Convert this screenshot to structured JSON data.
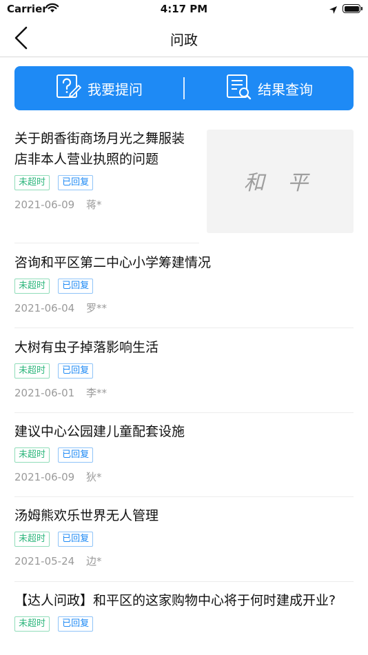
{
  "status_bar": {
    "carrier": "Carrier",
    "time": "4:17 PM"
  },
  "nav": {
    "title": "问政"
  },
  "actions": {
    "ask_label": "我要提问",
    "result_label": "结果查询"
  },
  "items": [
    {
      "title": "关于朗香街商场月光之舞服装店非本人营业执照的问题",
      "tag_time": "未超时",
      "tag_reply": "已回复",
      "date": "2021-06-09",
      "name": "蒋*",
      "thumb_text": "和 平"
    },
    {
      "title": "咨询和平区第二中心小学筹建情况",
      "tag_time": "未超时",
      "tag_reply": "已回复",
      "date": "2021-06-04",
      "name": "罗**"
    },
    {
      "title": "大树有虫子掉落影响生活",
      "tag_time": "未超时",
      "tag_reply": "已回复",
      "date": "2021-06-01",
      "name": "李**"
    },
    {
      "title": "建议中心公园建儿童配套设施",
      "tag_time": "未超时",
      "tag_reply": "已回复",
      "date": "2021-06-09",
      "name": "狄*"
    },
    {
      "title": "汤姆熊欢乐世界无人管理",
      "tag_time": "未超时",
      "tag_reply": "已回复",
      "date": "2021-05-24",
      "name": "边*"
    },
    {
      "title": "【达人问政】和平区的这家购物中心将于何时建成开业?",
      "tag_time": "未超时",
      "tag_reply": "已回复"
    }
  ]
}
